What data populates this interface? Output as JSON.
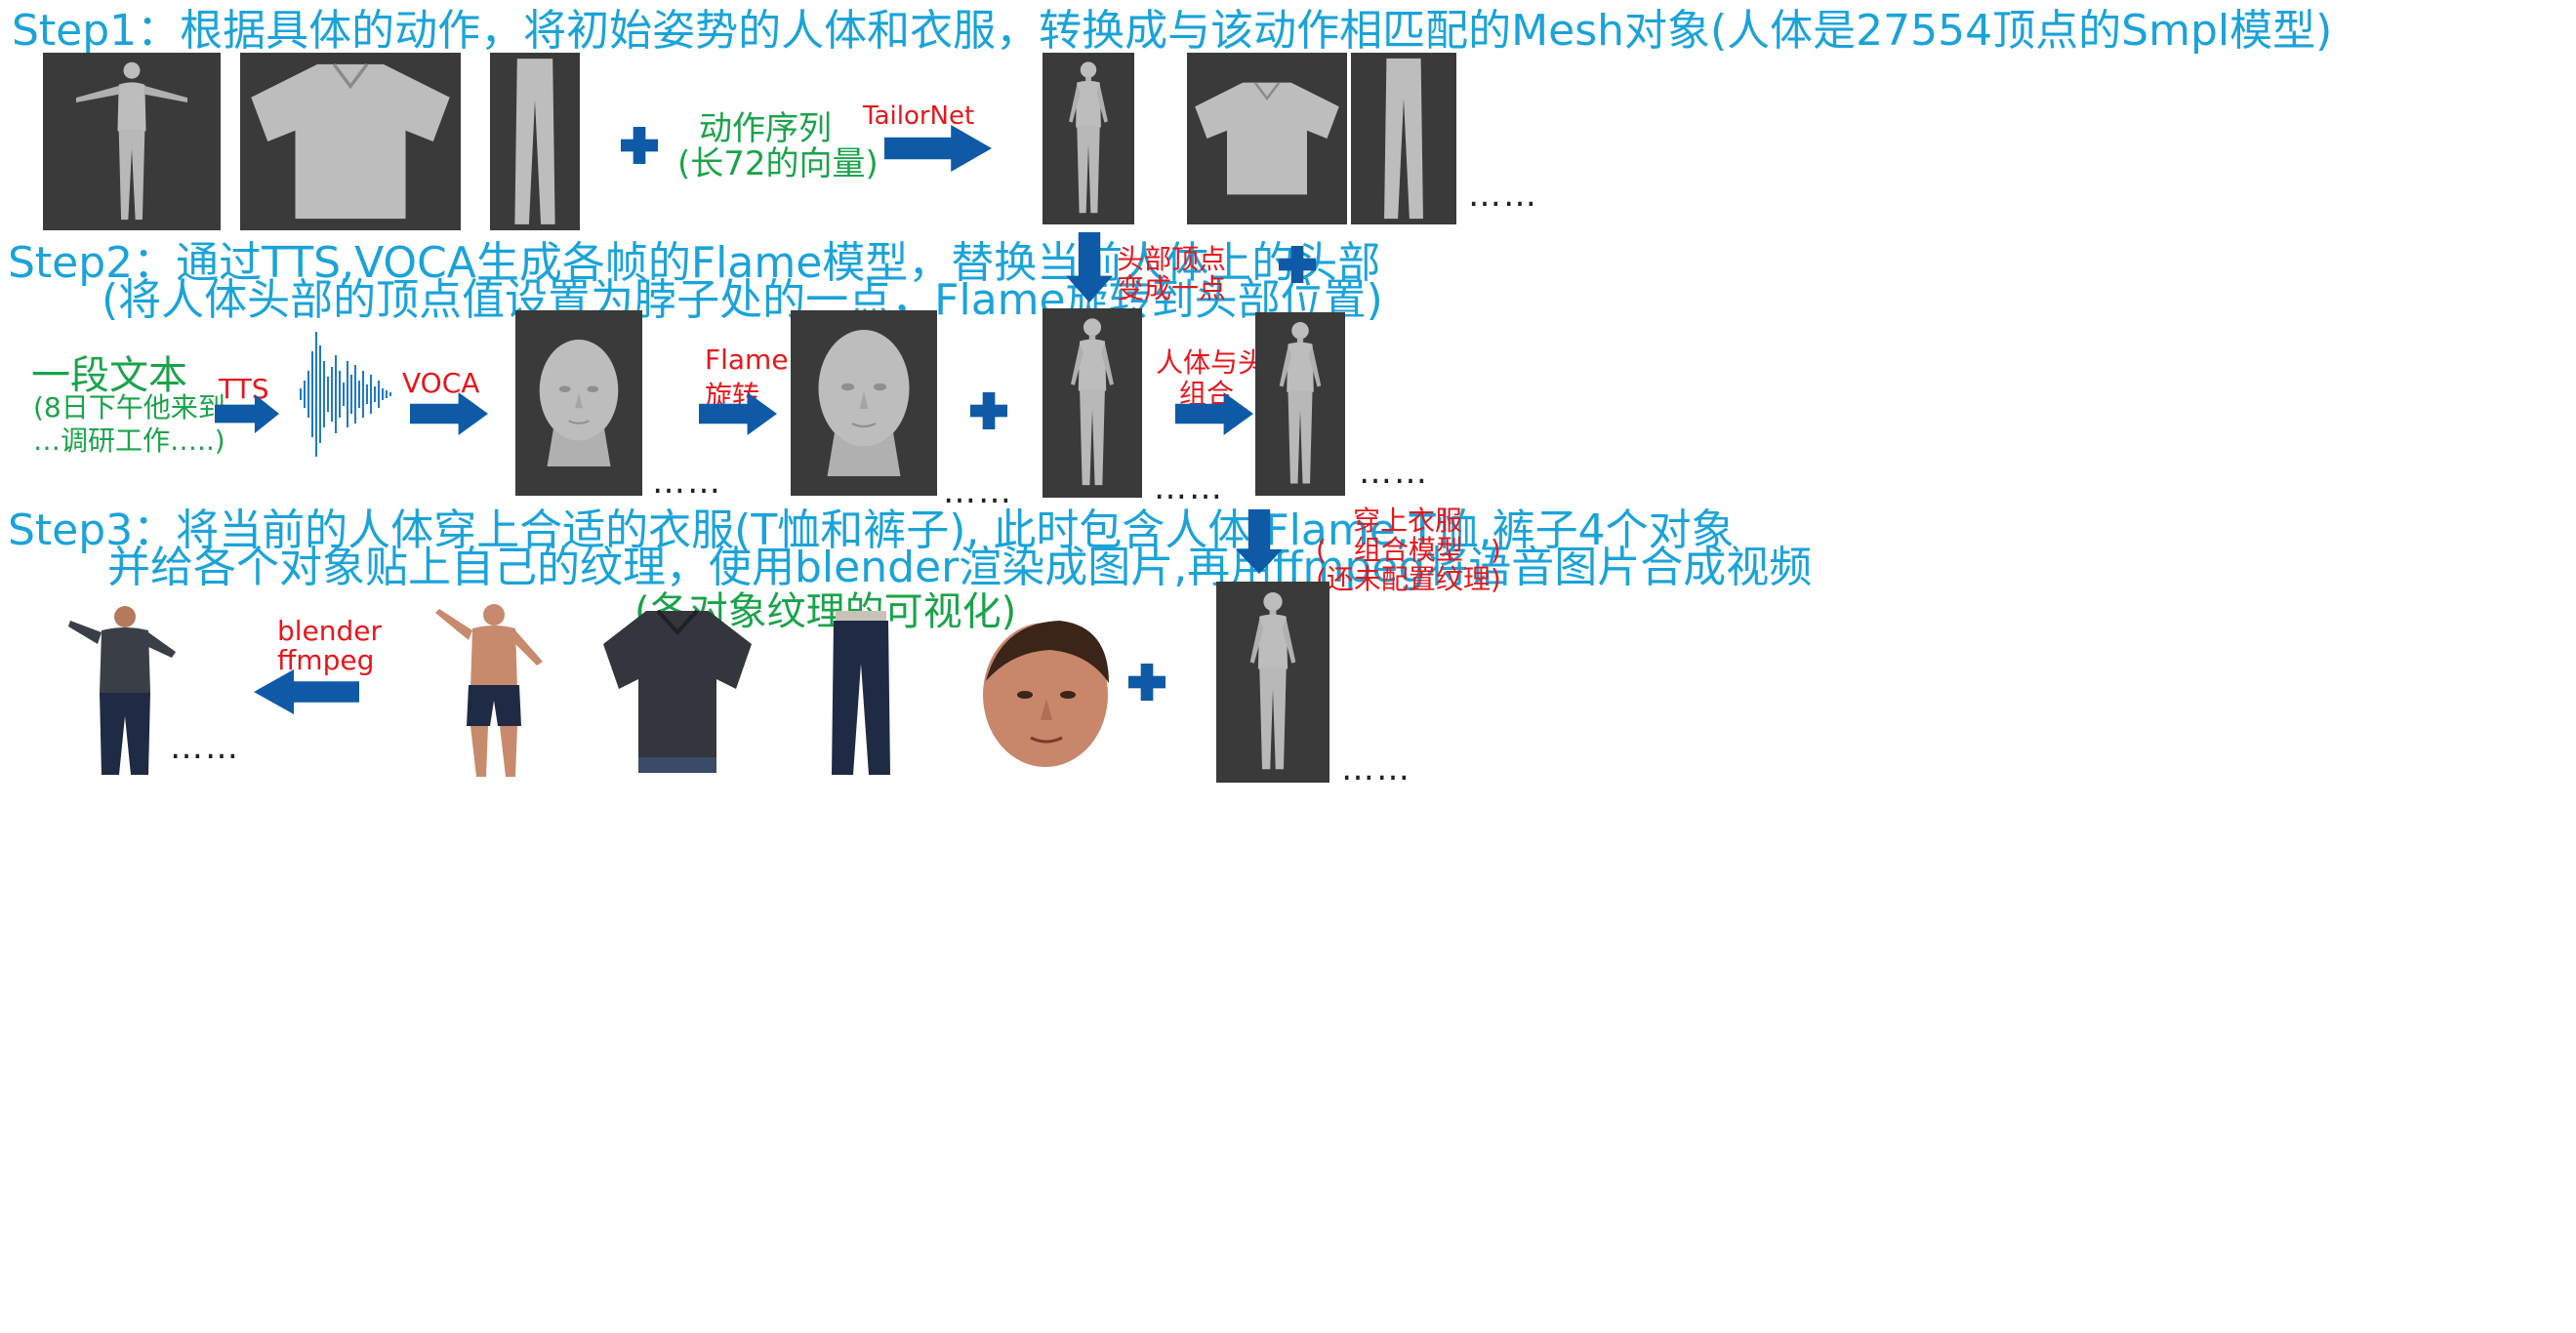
{
  "step1": {
    "title": "Step1：根据具体的动作，将初始姿势的人体和衣服，转换成与该动作相匹配的Mesh对象(人体是27554顶点的Smpl模型)",
    "motion_line1": "动作序列",
    "motion_line2": "(长72的向量)",
    "arrow_label": "TailorNet"
  },
  "step2": {
    "title_line1": "Step2：通过TTS,VOCA生成各帧的Flame模型，替换当前人体上的头部",
    "title_line2": "(将人体头部的顶点值设置为脖子处的一点，Flame旋转到头部位置)",
    "text_title": "一段文本",
    "text_line1": "(8日下午他来到",
    "text_line2": "…调研工作…..)",
    "tts_label": "TTS",
    "voca_label": "VOCA",
    "flame_label1": "Flame",
    "flame_label2": "旋转",
    "head_label1": "头部顶点",
    "head_label2": "变成一点",
    "combine_label1": "人体与头",
    "combine_label2": "组合"
  },
  "step3": {
    "title_line1": "Step3：将当前的人体穿上合适的衣服(T恤和裤子), 此时包含人体,Flame,T恤,裤子4个对象",
    "title_line2": "并给各个对象贴上自己的纹理，使用blender渲染成图片,再用ffmpeg将语音图片合成视频",
    "title_line3": "(各对象纹理的可视化)",
    "dress_label1": "穿上衣服",
    "dress_label2": "(　组合模型　)",
    "dress_label3": "(还未配置纹理)",
    "blender_label1": "blender",
    "blender_label2": "ffmpeg"
  },
  "ellipsis": "……",
  "colors": {
    "step_text": "#1aa3d9",
    "green_text": "#1aa34a",
    "red_text": "#e8161c",
    "arrow_blue": "#0e5aa7",
    "panel_bg": "#3a3a3a",
    "mesh_gray": "#b8b8b8"
  }
}
